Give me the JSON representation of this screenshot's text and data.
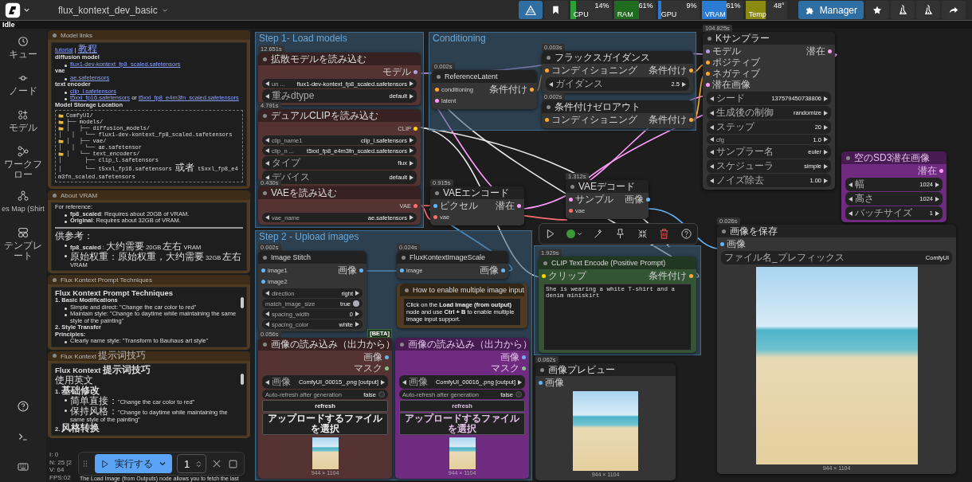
{
  "top_bar": {
    "workflow_title": "flux_kontext_dev_basic",
    "monitors": [
      {
        "label": "CPU",
        "value": "14%",
        "level": 0.14,
        "color": "#2e9e3a"
      },
      {
        "label": "RAM",
        "value": "61%",
        "level": 0.61,
        "color": "#1f6b1f"
      },
      {
        "label": "GPU",
        "value": "9%",
        "level": 0.09,
        "color": "#2a7bd4"
      },
      {
        "label": "VRAM",
        "value": "61%",
        "level": 0.61,
        "color": "#2a7bd4"
      },
      {
        "label": "Temp",
        "value": "48°",
        "level": 0.48,
        "color": "#8a8a10"
      }
    ],
    "manager_button": "Manager"
  },
  "status": "Idle",
  "sidebar": {
    "items": [
      {
        "label": "キュー"
      },
      {
        "label": "ノード"
      },
      {
        "label": "モデル"
      },
      {
        "label": "ワークフロー"
      },
      {
        "label": "es Map (Shirt"
      },
      {
        "label": "テンプレート"
      }
    ]
  },
  "notes": [
    {
      "title": "Model links",
      "blocks": [
        {
          "kind": "p",
          "parts": [
            {
              "text": "tutorial",
              "link": true
            },
            {
              "text": " | ",
              "link": false
            },
            {
              "text": "教程",
              "link": true
            }
          ]
        },
        {
          "kind": "h4",
          "text": "diffusion model"
        },
        {
          "kind": "bullet",
          "parts": [
            {
              "text": "flux1-dev-kontext_fp8_scaled.safetensors",
              "link": true
            }
          ]
        },
        {
          "kind": "h4",
          "text": "vae"
        },
        {
          "kind": "bullet",
          "parts": [
            {
              "text": "ae.safetensors",
              "link": true
            }
          ]
        },
        {
          "kind": "h4",
          "text": "text encoder"
        },
        {
          "kind": "bullet",
          "parts": [
            {
              "text": "clip_l.safetensors",
              "link": true
            }
          ]
        },
        {
          "kind": "bullet",
          "parts": [
            {
              "text": "t5xxl_fp16.safetensors",
              "link": true
            },
            {
              "text": " or ",
              "link": false
            },
            {
              "text": "t5xxl_fp8_e4m3fn_scaled.safetensors",
              "link": true
            }
          ]
        },
        {
          "kind": "h4",
          "text": "Model Storage Location"
        },
        {
          "kind": "tree",
          "lines": [
            {
              "text": "ComfyUI/",
              "folder": true
            },
            {
              "text": "├── models/",
              "folder": true
            },
            {
              "text": "│   ├── diffusion_models/",
              "folder": true
            },
            {
              "text": "│   │   └── flux1-dev-kontext_fp8_scaled.safetensors",
              "folder": false
            },
            {
              "text": "│   ├── vae/",
              "folder": true
            },
            {
              "text": "│   │   └── ae.safetensor",
              "folder": false
            },
            {
              "text": "│   └── text_encoders/",
              "folder": true
            },
            {
              "text": "│       ├── clip_l.safetensors",
              "folder": false
            },
            {
              "text": "│       └── t5xxl_fp16.safetensors 或者 t5xxl_fp8_e4m3fn_scaled.safetensors",
              "folder": false
            }
          ]
        }
      ]
    },
    {
      "title": "About VRAM",
      "blocks": [
        {
          "kind": "p",
          "text": "For reference:"
        },
        {
          "kind": "bullet",
          "text": "**fp8_scaled**: Requires about 20GB of VRAM."
        },
        {
          "kind": "bullet",
          "text": "**Original**: Requires about 32GB of VRAM."
        },
        {
          "kind": "rule"
        },
        {
          "kind": "p",
          "text": "供参考："
        },
        {
          "kind": "bullet",
          "text": "**fp8_scaled** : 大约需要 20GB 左右 VRAM"
        },
        {
          "kind": "bullet",
          "text": "原始权重：原始权重，大约需要 32GB 左右 VRAM"
        }
      ]
    },
    {
      "title": "Flux Kontext Prompt Techniques",
      "blocks": [
        {
          "kind": "h2",
          "text": "Flux Kontext Prompt Techniques"
        },
        {
          "kind": "h3",
          "text": "1. Basic Modifications"
        },
        {
          "kind": "bullet",
          "text": "Simple and direct: \"Change the car color to red\""
        },
        {
          "kind": "bullet",
          "text": "Maintain style: \"Change to daytime while maintaining the same style of the painting\""
        },
        {
          "kind": "h3",
          "text": "2. Style Transfer"
        },
        {
          "kind": "h4",
          "text": "Principles:"
        },
        {
          "kind": "bullet",
          "text": "Clearly name style: \"Transform to Bauhaus art style\""
        }
      ]
    },
    {
      "title": "Flux Kontext 提示词技巧",
      "blocks": [
        {
          "kind": "h2",
          "text": "Flux Kontext 提示词技巧"
        },
        {
          "kind": "p",
          "text": "使用英文"
        },
        {
          "kind": "h3",
          "text": "1. 基础修改"
        },
        {
          "kind": "bullet",
          "text": "简单直接：\"Change the car color to red\""
        },
        {
          "kind": "bullet",
          "text": "保持风格：\"Change to daytime while maintaining the same style of the painting\""
        },
        {
          "kind": "h3",
          "text": "2. 风格转换"
        }
      ]
    }
  ],
  "groups": [
    {
      "title": "Step 1- Load models"
    },
    {
      "title": "Conditioning"
    },
    {
      "title": "Step 2 - Upload images"
    }
  ],
  "nodes": [
    {
      "kind": "node",
      "title": "拡散モデルを読み込む",
      "timing": "12.651s",
      "color": "#553333",
      "bypassed": false,
      "outputs": [
        {
          "label": "モデル",
          "color": "#b39ddb"
        }
      ],
      "widgets": [
        {
          "kind": "combo",
          "label": "un ...",
          "value": "flux1-dev-kontext_fp8_scaled.safetensors"
        },
        {
          "kind": "combo",
          "label": "重みdtype",
          "value": "default"
        }
      ]
    },
    {
      "kind": "node",
      "title": "デュアルCLIPを読み込む",
      "timing": "4.791s",
      "color": "#553333",
      "bypassed": false,
      "outputs": [
        {
          "label": "CLIP",
          "color": "#ffd500"
        }
      ],
      "widgets": [
        {
          "kind": "combo",
          "label": "clip_name1",
          "value": "clip_l.safetensors"
        },
        {
          "kind": "combo",
          "label": "clip_n ...",
          "value": "t5xxl_fp8_e4m3fn_scaled.safetensors"
        },
        {
          "kind": "combo",
          "label": "タイプ",
          "value": "flux"
        },
        {
          "kind": "combo",
          "label": "デバイス",
          "value": "default"
        }
      ]
    },
    {
      "kind": "node",
      "title": "VAEを読み込む",
      "timing": "0.430s",
      "color": "#553333",
      "bypassed": false,
      "outputs": [
        {
          "label": "VAE",
          "color": "#ff6e6e"
        }
      ],
      "widgets": [
        {
          "kind": "combo",
          "label": "vae_name",
          "value": "ae.safetensors"
        }
      ]
    },
    {
      "kind": "node",
      "title": "ReferenceLatent",
      "timing": "0.002s",
      "bypassed": false,
      "inputs": [
        {
          "label": "conditioning",
          "color": "#ffa931"
        },
        {
          "label": "latent",
          "color": "#ff9cf9"
        }
      ],
      "outputs": [
        {
          "label": "条件付け",
          "color": "#ffa931"
        }
      ]
    },
    {
      "kind": "node",
      "title": "フラックスガイダンス",
      "timing": "0.003s",
      "bypassed": false,
      "inputs": [
        {
          "label": "コンディショニング",
          "color": "#ffa931"
        }
      ],
      "outputs": [
        {
          "label": "条件付け",
          "color": "#ffa931"
        }
      ],
      "widgets": [
        {
          "kind": "combo",
          "label": "ガイダンス",
          "value": "2.5"
        }
      ]
    },
    {
      "kind": "node",
      "title": "条件付けゼロアウト",
      "timing": "0.002s",
      "bypassed": false,
      "inputs": [
        {
          "label": "コンディショニング",
          "color": "#ffa931"
        }
      ],
      "outputs": [
        {
          "label": "条件付け",
          "color": "#ffa931"
        }
      ]
    },
    {
      "kind": "node",
      "title": "Kサンプラー",
      "timing": "104.825s",
      "bypassed": false,
      "inputs": [
        {
          "label": "モデル",
          "color": "#b39ddb"
        },
        {
          "label": "ポジティブ",
          "color": "#ffa931"
        },
        {
          "label": "ネガティブ",
          "color": "#ffa931"
        },
        {
          "label": "潜在画像",
          "color": "#ff9cf9"
        }
      ],
      "outputs": [
        {
          "label": "潜在",
          "color": "#ff9cf9"
        }
      ],
      "widgets": [
        {
          "kind": "combo",
          "label": "シード",
          "value": "137579450738806"
        },
        {
          "kind": "combo",
          "label": "生成後の制御",
          "value": "randomize"
        },
        {
          "kind": "combo",
          "label": "ステップ",
          "value": "20"
        },
        {
          "kind": "combo",
          "label": "cfg",
          "value": "1.0"
        },
        {
          "kind": "combo",
          "label": "サンプラー名",
          "value": "euler"
        },
        {
          "kind": "combo",
          "label": "スケジューラ",
          "value": "simple"
        },
        {
          "kind": "combo",
          "label": "ノイズ除去",
          "value": "1.00"
        }
      ]
    },
    {
      "kind": "node",
      "title": "VAEエンコード",
      "timing": "0.915s",
      "bypassed": false,
      "inputs": [
        {
          "label": "ピクセル",
          "color": "#64b5f6"
        },
        {
          "label": "vae",
          "color": "#ff6e6e"
        }
      ],
      "outputs": [
        {
          "label": "潜在",
          "color": "#ff9cf9"
        }
      ]
    },
    {
      "kind": "node",
      "title": "VAEデコード",
      "timing": "1.312s",
      "bypassed": false,
      "inputs": [
        {
          "label": "サンプル",
          "color": "#ff9cf9"
        },
        {
          "label": "vae",
          "color": "#ff6e6e"
        }
      ],
      "outputs": [
        {
          "label": "画像",
          "color": "#64b5f6"
        }
      ]
    },
    {
      "kind": "node",
      "title": "空のSD3潜在画像",
      "bypassed": true,
      "outputs": [
        {
          "label": "潜在",
          "color": "#ff9cf9"
        }
      ],
      "widgets": [
        {
          "kind": "combo",
          "label": "幅",
          "value": "1024"
        },
        {
          "kind": "combo",
          "label": "高さ",
          "value": "1024"
        },
        {
          "kind": "combo",
          "label": "バッチサイズ",
          "value": "1"
        }
      ]
    },
    {
      "kind": "node",
      "title": "Image Stitch",
      "timing": "0.002s",
      "bypassed": false,
      "inputs": [
        {
          "label": "image1",
          "color": "#64b5f6"
        },
        {
          "label": "image2",
          "color": "#64b5f6"
        }
      ],
      "outputs": [
        {
          "label": "画像",
          "color": "#64b5f6"
        }
      ],
      "widgets": [
        {
          "kind": "combo",
          "label": "direction",
          "value": "right"
        },
        {
          "kind": "toggle",
          "label": "match_image_size",
          "value": "true",
          "on": true
        },
        {
          "kind": "combo",
          "label": "spacing_width",
          "value": "0"
        },
        {
          "kind": "combo",
          "label": "spacing_color",
          "value": "white"
        }
      ]
    },
    {
      "kind": "node",
      "title": "FluxKontextImageScale",
      "timing": "0.024s",
      "bypassed": false,
      "inputs": [
        {
          "label": "image",
          "color": "#64b5f6"
        }
      ],
      "outputs": [
        {
          "label": "画像",
          "color": "#64b5f6"
        }
      ]
    },
    {
      "kind": "note",
      "title": "How to enable multiple image input",
      "text": "Click on the **Load Image (from output)** node and use **Ctrl + B** to enable multiple image input support."
    },
    {
      "kind": "node",
      "title": "画像の読み込み（出力から）",
      "timing": "0.056s",
      "badge": "[BETA]",
      "color": "#553333",
      "bypassed": false,
      "outputs": [
        {
          "label": "画像",
          "color": "#64b5f6"
        },
        {
          "label": "マスク",
          "color": "#81c784"
        }
      ],
      "widgets": [
        {
          "kind": "combo",
          "label": "画像",
          "value": "ComfyUI_00015_.png [output]"
        },
        {
          "kind": "toggle",
          "label": "Auto-refresh after generation",
          "value": "false",
          "on": false
        },
        {
          "kind": "button",
          "label": "refresh"
        },
        {
          "kind": "button",
          "label": "アップロードするファイルを選択"
        }
      ],
      "image": {
        "caption": "944 × 1104"
      }
    },
    {
      "kind": "node",
      "title": "画像の読み込み（出力から）",
      "bypassed": true,
      "outputs": [
        {
          "label": "画像",
          "color": "#64b5f6"
        },
        {
          "label": "マスク",
          "color": "#81c784"
        }
      ],
      "widgets": [
        {
          "kind": "combo",
          "label": "画像",
          "value": "ComfyUI_00016_.png [output]"
        },
        {
          "kind": "toggle",
          "label": "Auto-refresh after generation",
          "value": "false",
          "on": false
        },
        {
          "kind": "button",
          "label": "refresh"
        },
        {
          "kind": "button",
          "label": "アップロードするファイルを選択"
        }
      ],
      "image": {
        "caption": "944 × 1104"
      }
    },
    {
      "kind": "node",
      "title": "CLIP Text Encode (Positive Prompt)",
      "timing": "1.929s",
      "color": "#335533",
      "bypassed": false,
      "inputs": [
        {
          "label": "クリップ",
          "color": "#ffd500"
        }
      ],
      "outputs": [
        {
          "label": "条件付け",
          "color": "#ffa931"
        }
      ],
      "widgets": [
        {
          "kind": "textarea",
          "value": "She is wearing a white T-shirt and a denim miniskirt"
        }
      ]
    },
    {
      "kind": "node",
      "title": "画像プレビュー",
      "timing": "0.062s",
      "bypassed": false,
      "inputs": [
        {
          "label": "画像",
          "color": "#64b5f6"
        }
      ],
      "image": {
        "caption": "944 × 1104"
      }
    },
    {
      "kind": "node",
      "title": "画像を保存",
      "timing": "0.026s",
      "bypassed": false,
      "inputs": [
        {
          "label": "画像",
          "color": "#64b5f6"
        }
      ],
      "widgets": [
        {
          "kind": "field",
          "label": "ファイル名_プレフィックス",
          "value": "ComfyUI"
        }
      ],
      "image": {
        "caption": "944 × 1104"
      }
    }
  ],
  "canvas_stats": [
    "I: 0",
    "N: 25 [2",
    "V: 64",
    "FPS:02"
  ],
  "run_bar": {
    "run_button": "実行する",
    "count": "1"
  },
  "footnote": "The Load Image (from Outputs) node allows you to fetch the last"
}
